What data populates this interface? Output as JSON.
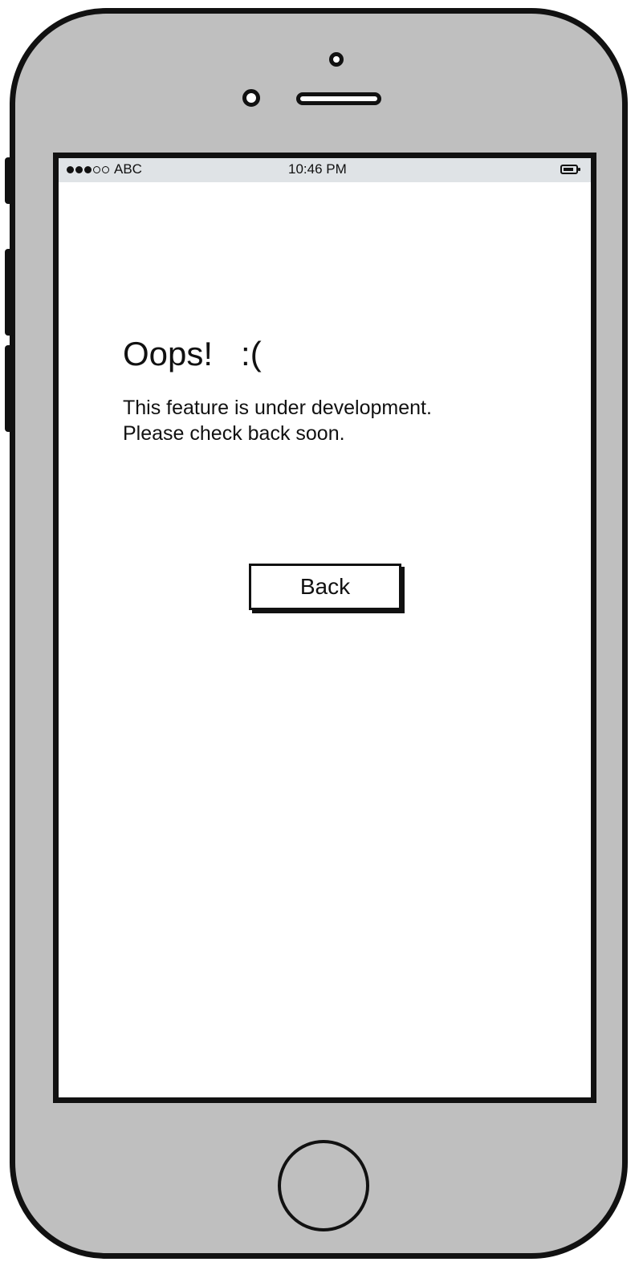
{
  "status_bar": {
    "carrier": "ABC",
    "time": "10:46 PM",
    "signal_strength": "3 of 5",
    "icons": [
      "signal-dots-icon",
      "battery-icon"
    ]
  },
  "content": {
    "title": "Oops!   :(",
    "message_line1": "This feature is under development.",
    "message_line2": "Please check back soon."
  },
  "actions": {
    "back_label": "Back"
  },
  "colors": {
    "device_body": "#bfbfbf",
    "outline": "#111111",
    "screen": "#ffffff",
    "status_bar": "#dfe3e6"
  }
}
